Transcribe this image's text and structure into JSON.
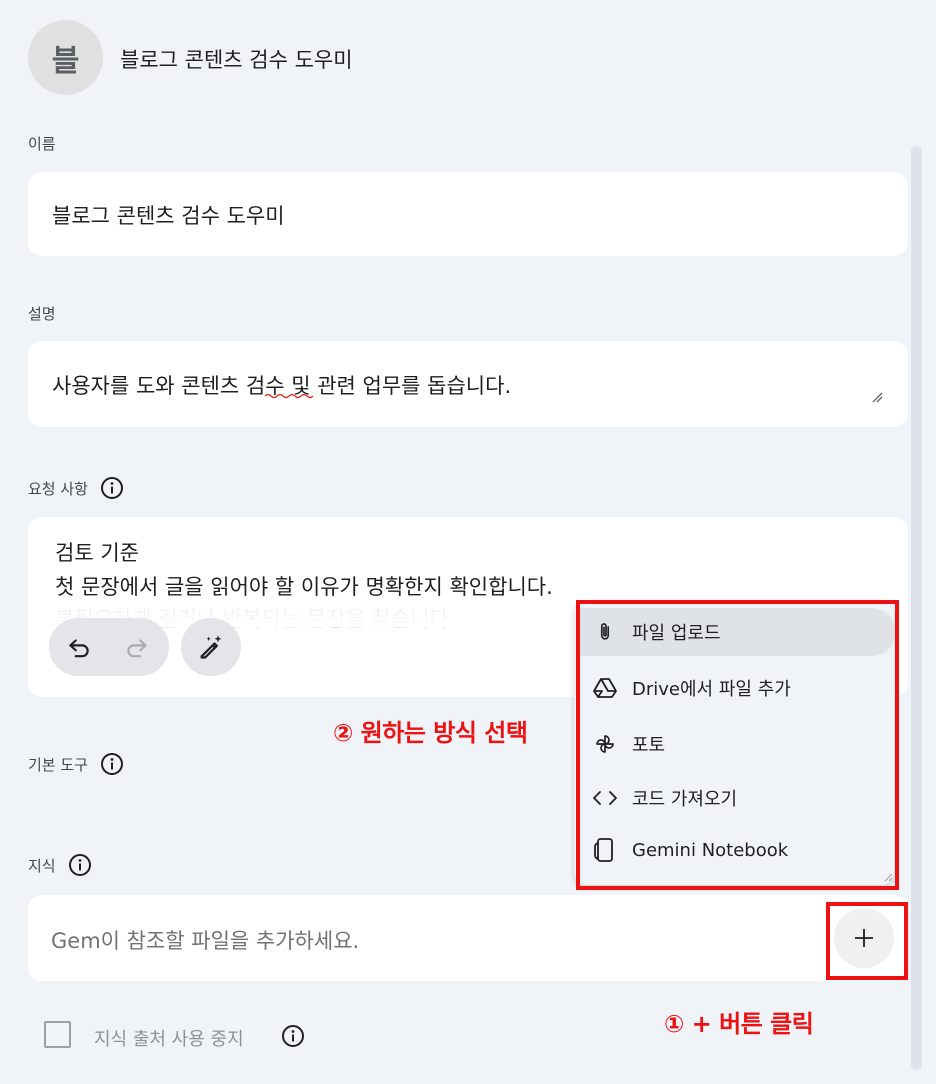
{
  "header": {
    "avatar_letter": "블",
    "title": "블로그 콘텐츠 검수 도우미"
  },
  "name_field": {
    "label": "이름",
    "value": "블로그 콘텐츠 검수 도우미"
  },
  "description_field": {
    "label": "설명",
    "value": "사용자를 도와 콘텐츠 검수 및 관련 업무를 돕습니다."
  },
  "instructions_field": {
    "label": "요청 사항",
    "line1": "검토 기준",
    "line2": "첫 문장에서 글을 읽어야 할 이유가 명확한지 확인합니다.",
    "line3_faded": "불필요하게 길거나 반복되는 문장을 찾습니다"
  },
  "default_tools": {
    "label": "기본 도구"
  },
  "knowledge": {
    "label": "지식",
    "placeholder": "Gem이 참조할 파일을 추가하세요.",
    "disable_sources_label": "지식 출처 사용 중지"
  },
  "menu": {
    "items": [
      {
        "label": "파일 업로드",
        "icon": "paperclip-icon"
      },
      {
        "label": "Drive에서 파일 추가",
        "icon": "drive-icon"
      },
      {
        "label": "포토",
        "icon": "pinwheel-icon"
      },
      {
        "label": "코드 가져오기",
        "icon": "code-icon"
      },
      {
        "label": "Gemini Notebook",
        "icon": "notebook-icon"
      }
    ]
  },
  "annotations": {
    "step2": "② 원하는 방식 선택",
    "step1": "① + 버튼 클릭"
  },
  "colors": {
    "background": "#f0f4f9",
    "field": "#ffffff",
    "annotation_red": "#ee1111"
  }
}
